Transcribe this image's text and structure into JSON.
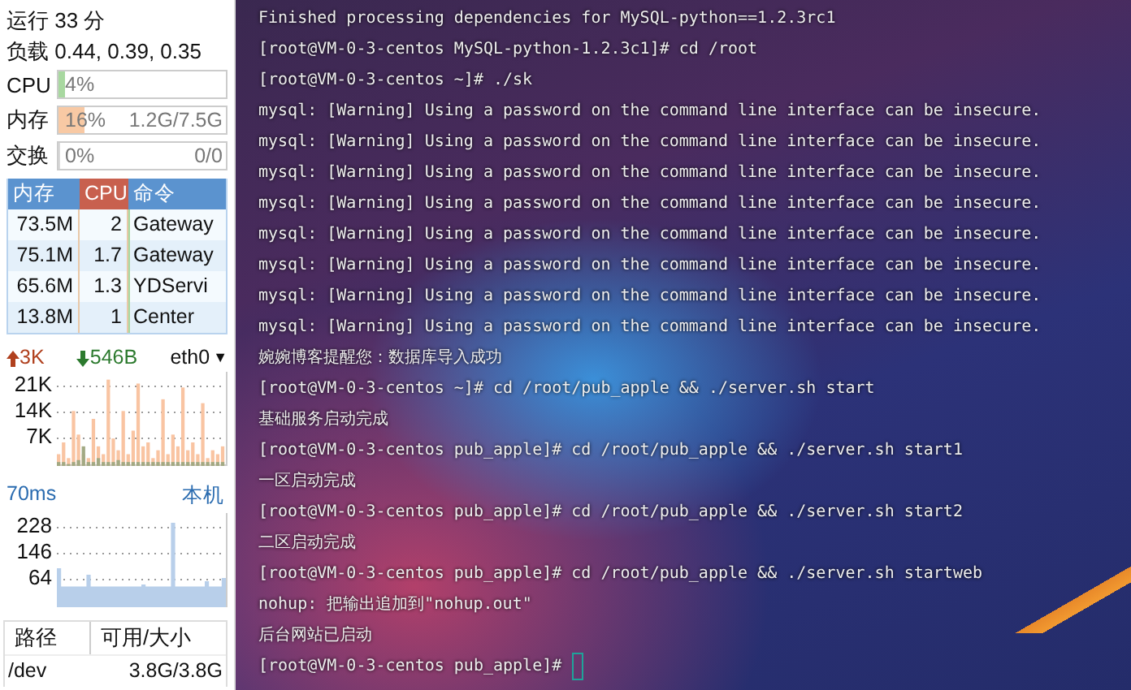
{
  "sysinfo": {
    "uptime": "运行 33 分",
    "load": "负载 0.44, 0.39, 0.35"
  },
  "meters": [
    {
      "label": "CPU",
      "level": 0.04,
      "color": "#a8d8a0",
      "reading": "4%"
    },
    {
      "label": "内存",
      "level": 0.16,
      "color": "#f8c9a4",
      "reading": "16%",
      "detail": "1.2G/7.5G"
    },
    {
      "label": "交换",
      "level": 0,
      "reading": "0%",
      "detail": "0/0"
    }
  ],
  "process_table": {
    "columns": [
      {
        "label": "内存",
        "selected": false
      },
      {
        "label": "CPU",
        "selected": true
      },
      {
        "label": "命令",
        "selected": false
      }
    ],
    "rows": [
      [
        "73.5M",
        "2",
        "Gateway"
      ],
      [
        "75.1M",
        "1.7",
        "Gateway"
      ],
      [
        "65.6M",
        "1.3",
        "YDServi"
      ],
      [
        "13.8M",
        "1",
        "Center"
      ]
    ]
  },
  "network": {
    "upload": "3K",
    "download": "546B",
    "interface": "eth0",
    "dropdown_glyph": "▼",
    "graph_labels": [
      "21K",
      "14K",
      "7K"
    ]
  },
  "ping": {
    "latency": "70ms",
    "host": "本机",
    "graph_labels": [
      "228",
      "146",
      "64"
    ]
  },
  "disks": {
    "columns": [
      "路径",
      "可用/大小"
    ],
    "rows": [
      [
        "/dev",
        "3.8G/3.8G"
      ]
    ]
  },
  "terminal": {
    "lines": [
      "Finished processing dependencies for MySQL-python==1.2.3rc1",
      "[root@VM-0-3-centos MySQL-python-1.2.3c1]# cd /root",
      "[root@VM-0-3-centos ~]# ./sk",
      "mysql: [Warning] Using a password on the command line interface can be insecure.",
      "mysql: [Warning] Using a password on the command line interface can be insecure.",
      "mysql: [Warning] Using a password on the command line interface can be insecure.",
      "mysql: [Warning] Using a password on the command line interface can be insecure.",
      "mysql: [Warning] Using a password on the command line interface can be insecure.",
      "mysql: [Warning] Using a password on the command line interface can be insecure.",
      "mysql: [Warning] Using a password on the command line interface can be insecure.",
      "mysql: [Warning] Using a password on the command line interface can be insecure.",
      "婉婉博客提醒您：数据库导入成功",
      "[root@VM-0-3-centos ~]# cd /root/pub_apple && ./server.sh start",
      "基础服务启动完成",
      "[root@VM-0-3-centos pub_apple]# cd /root/pub_apple && ./server.sh start1",
      "一区启动完成",
      "[root@VM-0-3-centos pub_apple]# cd /root/pub_apple && ./server.sh start2",
      "二区启动完成",
      "[root@VM-0-3-centos pub_apple]# cd /root/pub_apple && ./server.sh startweb",
      "nohup: 把输出追加到\"nohup.out\"",
      "后台网站已启动"
    ],
    "prompt": "[root@VM-0-3-centos pub_apple]#"
  }
}
